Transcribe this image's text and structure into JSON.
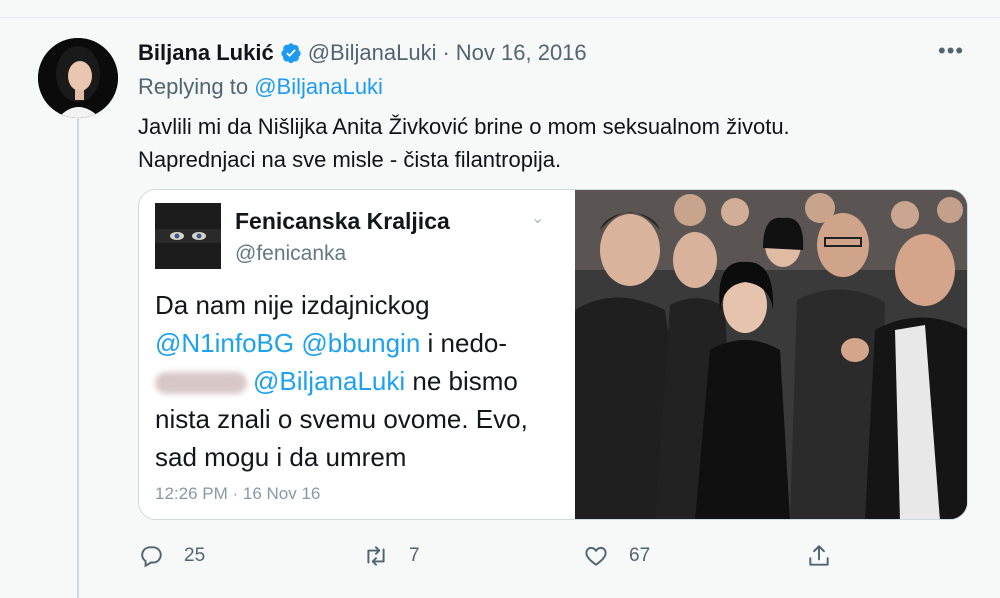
{
  "tweet": {
    "author_name": "Biljana Lukić",
    "handle": "@BiljanaLuki",
    "separator": "·",
    "date": "Nov 16, 2016",
    "more_label": "•••",
    "replying_prefix": "Replying to",
    "replying_mention": "@BiljanaLuki",
    "text_line1": "Javlili mi da Nišlijka Anita Živković brine o mom seksualnom životu.",
    "text_line2": "Naprednjaci na sve misle - čista filantropija."
  },
  "embedded": {
    "name": "Fenicanska Kraljica",
    "handle": "@fenicanka",
    "line1": "Da nam nije izdajnickog",
    "mention1": "@N1infoBG",
    "mention2": "@bbungin",
    "line2_tail": "i nedo-",
    "mention3": "@BiljanaLuki",
    "line3_tail": "ne bismo",
    "line4": "nista znali o svemu ovome. Evo,",
    "line5": "sad mogu i da umrem",
    "time": "12:26 PM · 16 Nov 16"
  },
  "actions": {
    "replies": "25",
    "retweets": "7",
    "likes": "67"
  },
  "colors": {
    "accent": "#1d9bf0",
    "secondary_text": "#536471",
    "verified": "#1d9bf0"
  },
  "icons": [
    "verified-badge-icon",
    "more-icon",
    "chevron-down-icon",
    "reply-icon",
    "retweet-icon",
    "like-icon",
    "share-icon"
  ]
}
